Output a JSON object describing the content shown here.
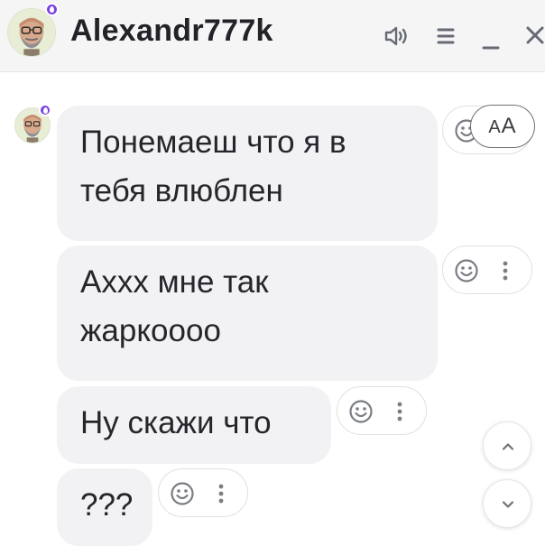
{
  "header": {
    "contact_name": "Alexandr777k",
    "icons": [
      "volume-icon",
      "menu-icon",
      "minimize-icon",
      "close-icon"
    ]
  },
  "messages": [
    {
      "line1": "Понемаеш что я в",
      "line2": "тебя влюблен"
    },
    {
      "line1": "Ахxх мне так",
      "line2": "жаркоооо"
    },
    {
      "line1": "Ну скажи что"
    },
    {
      "line1": "???"
    }
  ],
  "font_size_button": {
    "big": "A",
    "small": "A"
  },
  "colors": {
    "status_badge": "#7b3fe4",
    "bubble_bg": "#f2f2f4",
    "header_bg": "#f5f5f6"
  }
}
